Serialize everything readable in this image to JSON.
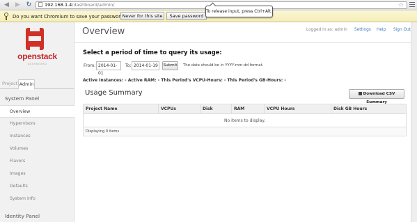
{
  "browser": {
    "url_host": "192.168.1.4",
    "url_path": "/dashboard/admin/",
    "infobar": {
      "message": "Do you want Chromium to save your password?",
      "never_label": "Never for this site",
      "save_label": "Save password"
    },
    "tooltip": "To release input, press Ctrl+Alt."
  },
  "sidebar": {
    "logo_text": "openstack",
    "logo_sub": "DASHBOARD",
    "tabs": [
      {
        "label": "Project",
        "active": false
      },
      {
        "label": "Admin",
        "active": true
      }
    ],
    "system_panel_title": "System Panel",
    "items": [
      {
        "label": "Overview",
        "active": true
      },
      {
        "label": "Hypervisors",
        "active": false
      },
      {
        "label": "Instances",
        "active": false
      },
      {
        "label": "Volumes",
        "active": false
      },
      {
        "label": "Flavors",
        "active": false
      },
      {
        "label": "Images",
        "active": false
      },
      {
        "label": "Defaults",
        "active": false
      },
      {
        "label": "System Info",
        "active": false
      }
    ],
    "identity_panel_title": "Identity Panel"
  },
  "header": {
    "title": "Overview",
    "logged_in": "Logged in as: admin",
    "settings": "Settings",
    "help": "Help",
    "sign_out": "Sign Out"
  },
  "query": {
    "title": "Select a period of time to query its usage:",
    "from_label": "From:",
    "from_value": "2014-01-01",
    "to_label": "To:",
    "to_value": "2014-01-19",
    "submit_label": "Submit",
    "hint": "The date should be in YYYY-mm-dd format."
  },
  "summary_line": "Active Instances: - Active RAM: - This Period's VCPU-Hours: - This Period's GB-Hours: -",
  "usage": {
    "title": "Usage Summary",
    "csv_label": "Download CSV Summary",
    "columns": [
      "Project Name",
      "VCPUs",
      "Disk",
      "RAM",
      "VCPU Hours",
      "Disk GB Hours"
    ],
    "empty_message": "No items to display.",
    "footer": "Displaying 0 items"
  }
}
